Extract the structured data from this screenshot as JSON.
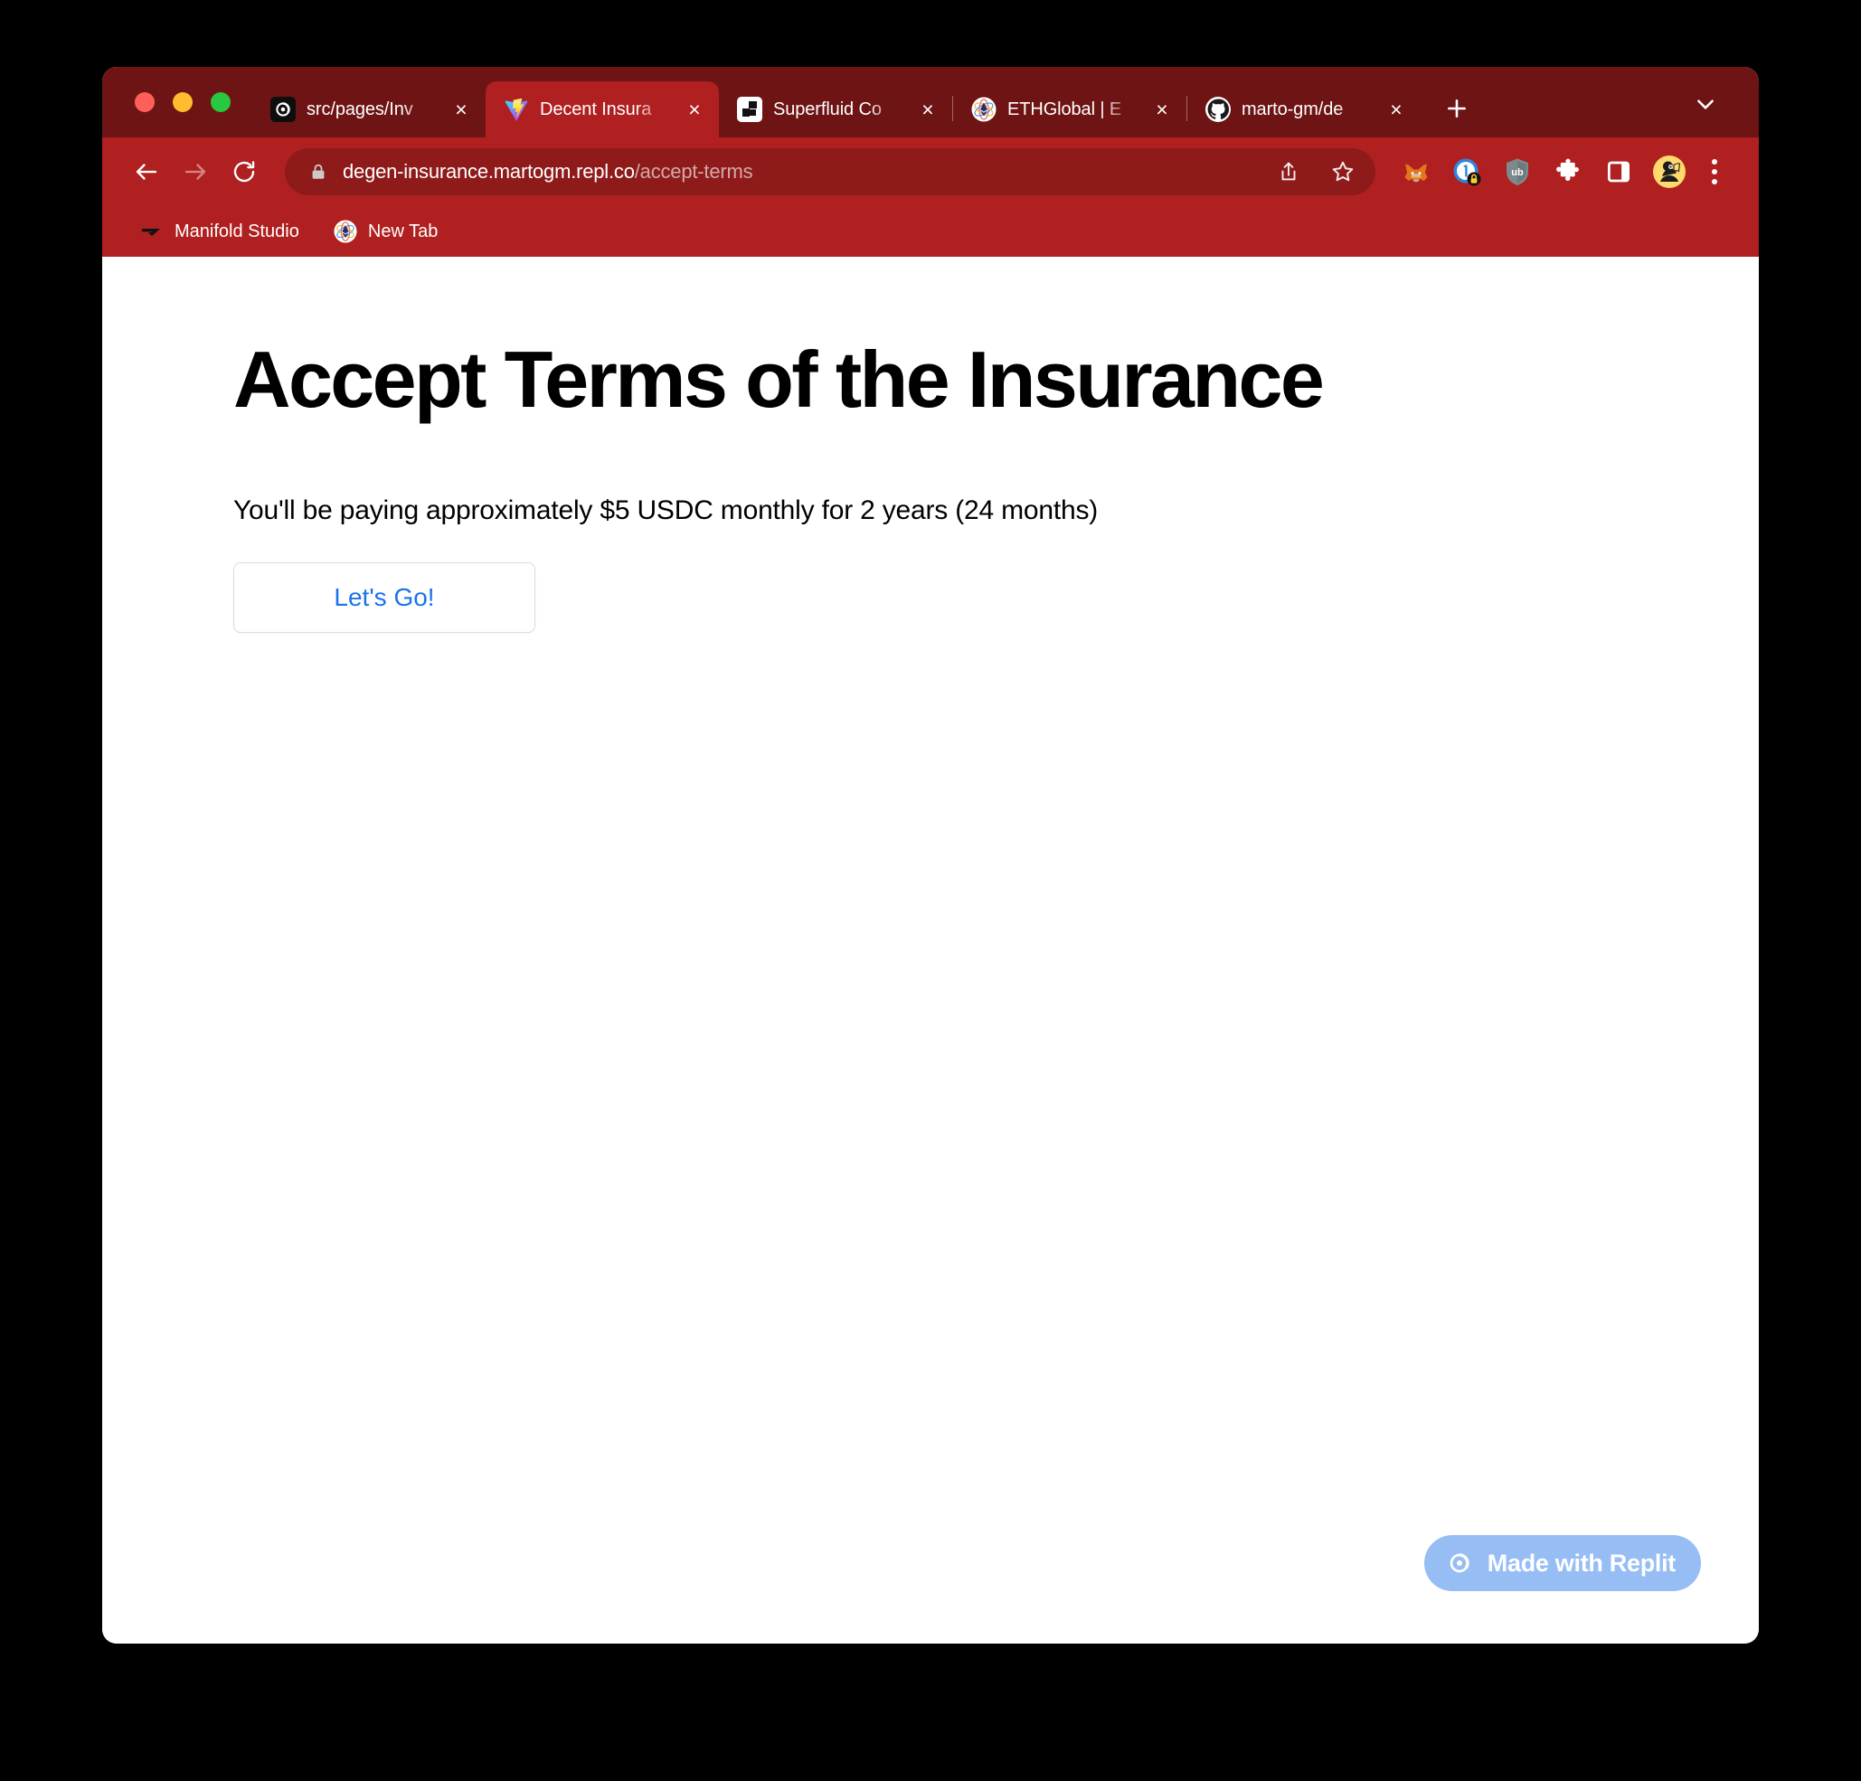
{
  "window": {
    "traffic_lights": [
      "close",
      "minimize",
      "zoom"
    ]
  },
  "tabs": [
    {
      "title": "src/pages/Inv",
      "favicon": "replit-icon",
      "active": false
    },
    {
      "title": "Decent Insura",
      "favicon": "vite-icon",
      "active": true
    },
    {
      "title": "Superfluid Co",
      "favicon": "superfluid-icon",
      "active": false
    },
    {
      "title": "ETHGlobal | E",
      "favicon": "ethglobal-icon",
      "active": false
    },
    {
      "title": "marto-gm/de",
      "favicon": "github-icon",
      "active": false
    }
  ],
  "tab_controls": {
    "new_tab_label": "+",
    "tab_search_label": "v",
    "close_label": "×"
  },
  "toolbar": {
    "back_label": "←",
    "forward_label": "→",
    "reload_label": "↻",
    "security_icon": "lock-icon",
    "url_host": "degen-insurance.martogm.repl.co",
    "url_path": "/accept-terms",
    "share_icon": "share-icon",
    "bookmark_icon": "star-icon",
    "extensions": [
      "metamask-icon",
      "1password-icon",
      "ublock-origin-icon",
      "puzzle-extensions-icon",
      "side-panel-icon",
      "profile-avatar-icon"
    ],
    "menu_icon": "three-dot-menu-icon"
  },
  "bookmarks": [
    {
      "label": "Manifold Studio",
      "icon": "manifold-icon"
    },
    {
      "label": "New Tab",
      "icon": "ethglobal-icon"
    }
  ],
  "main": {
    "title": "Accept Terms of the Insurance",
    "subtitle": "You'll be paying approximately $5 USDC monthly for 2 years (24 months)",
    "cta_label": "Let's Go!"
  },
  "footer_badge": {
    "label": "Made with Replit",
    "icon": "replit-icon"
  },
  "colors": {
    "tab_strip_bg": "#6e1414",
    "toolbar_bg": "#b02020",
    "active_tab_bg": "#b02020",
    "omnibox_bg": "#8e1a1a",
    "page_bg": "#ffffff",
    "cta_text": "#1a73e8",
    "badge_bg": "#97bdf5"
  }
}
